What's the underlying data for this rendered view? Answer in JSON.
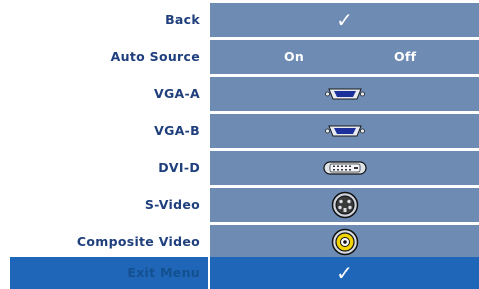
{
  "menu": {
    "back": {
      "label": "Back",
      "icon": "checkmark-icon"
    },
    "auto_source": {
      "label": "Auto Source",
      "on": "On",
      "off": "Off"
    },
    "sources": [
      {
        "label": "VGA-A",
        "icon": "vga-connector-icon"
      },
      {
        "label": "VGA-B",
        "icon": "vga-connector-icon"
      },
      {
        "label": "DVI-D",
        "icon": "dvi-connector-icon"
      },
      {
        "label": "S-Video",
        "icon": "s-video-connector-icon"
      },
      {
        "label": "Composite Video",
        "icon": "rca-connector-icon"
      }
    ],
    "exit": {
      "label": "Exit Menu",
      "icon": "checkmark-icon"
    }
  },
  "colors": {
    "label_text": "#1f3f7d",
    "panel": "#6d8bb3",
    "exit_bar": "#1f66b8"
  }
}
